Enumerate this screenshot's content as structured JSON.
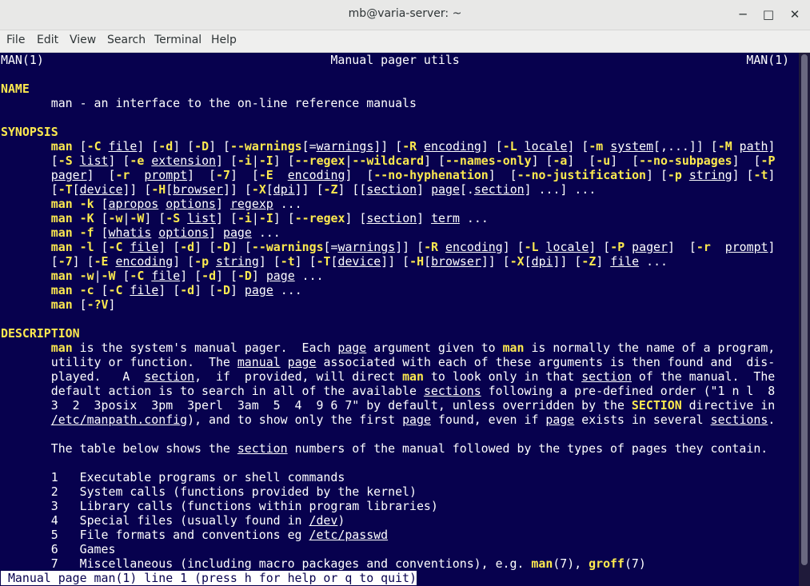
{
  "window": {
    "title": "mb@varia-server: ~",
    "minimize_label": "─",
    "maximize_label": "□",
    "close_label": "✕"
  },
  "menubar": [
    "File",
    "Edit",
    "View",
    "Search",
    "Terminal",
    "Help"
  ],
  "terminal": {
    "lines": [
      [
        {
          "t": "MAN(1)                                        Manual pager utils                                        MAN(1)"
        }
      ],
      [],
      [
        {
          "t": "NAME",
          "s": "b"
        }
      ],
      [
        {
          "t": "       man - an interface to the on-line reference manuals"
        }
      ],
      [],
      [
        {
          "t": "SYNOPSIS",
          "s": "b"
        }
      ],
      [
        {
          "t": "       "
        },
        {
          "t": "man",
          "s": "b"
        },
        {
          "t": " ["
        },
        {
          "t": "-C",
          "s": "b"
        },
        {
          "t": " "
        },
        {
          "t": "file",
          "s": "u"
        },
        {
          "t": "] ["
        },
        {
          "t": "-d",
          "s": "b"
        },
        {
          "t": "] ["
        },
        {
          "t": "-D",
          "s": "b"
        },
        {
          "t": "] ["
        },
        {
          "t": "--warnings",
          "s": "b"
        },
        {
          "t": "[="
        },
        {
          "t": "warnings",
          "s": "u"
        },
        {
          "t": "]] ["
        },
        {
          "t": "-R",
          "s": "b"
        },
        {
          "t": " "
        },
        {
          "t": "encoding",
          "s": "u"
        },
        {
          "t": "] ["
        },
        {
          "t": "-L",
          "s": "b"
        },
        {
          "t": " "
        },
        {
          "t": "locale",
          "s": "u"
        },
        {
          "t": "] ["
        },
        {
          "t": "-m",
          "s": "b"
        },
        {
          "t": " "
        },
        {
          "t": "system",
          "s": "u"
        },
        {
          "t": "[,...]] ["
        },
        {
          "t": "-M",
          "s": "b"
        },
        {
          "t": " "
        },
        {
          "t": "path",
          "s": "u"
        },
        {
          "t": "]"
        }
      ],
      [
        {
          "t": "       ["
        },
        {
          "t": "-S",
          "s": "b"
        },
        {
          "t": " "
        },
        {
          "t": "list",
          "s": "u"
        },
        {
          "t": "] ["
        },
        {
          "t": "-e",
          "s": "b"
        },
        {
          "t": " "
        },
        {
          "t": "extension",
          "s": "u"
        },
        {
          "t": "] ["
        },
        {
          "t": "-i",
          "s": "b"
        },
        {
          "t": "|"
        },
        {
          "t": "-I",
          "s": "b"
        },
        {
          "t": "] ["
        },
        {
          "t": "--regex",
          "s": "b"
        },
        {
          "t": "|"
        },
        {
          "t": "--wildcard",
          "s": "b"
        },
        {
          "t": "] ["
        },
        {
          "t": "--names-only",
          "s": "b"
        },
        {
          "t": "] ["
        },
        {
          "t": "-a",
          "s": "b"
        },
        {
          "t": "]  ["
        },
        {
          "t": "-u",
          "s": "b"
        },
        {
          "t": "]  ["
        },
        {
          "t": "--no-subpages",
          "s": "b"
        },
        {
          "t": "]  ["
        },
        {
          "t": "-P",
          "s": "b"
        }
      ],
      [
        {
          "t": "       "
        },
        {
          "t": "pager",
          "s": "u"
        },
        {
          "t": "]  ["
        },
        {
          "t": "-r",
          "s": "b"
        },
        {
          "t": "  "
        },
        {
          "t": "prompt",
          "s": "u"
        },
        {
          "t": "]  ["
        },
        {
          "t": "-7",
          "s": "b"
        },
        {
          "t": "]  ["
        },
        {
          "t": "-E",
          "s": "b"
        },
        {
          "t": "  "
        },
        {
          "t": "encoding",
          "s": "u"
        },
        {
          "t": "]  ["
        },
        {
          "t": "--no-hyphenation",
          "s": "b"
        },
        {
          "t": "]  ["
        },
        {
          "t": "--no-justification",
          "s": "b"
        },
        {
          "t": "] ["
        },
        {
          "t": "-p",
          "s": "b"
        },
        {
          "t": " "
        },
        {
          "t": "string",
          "s": "u"
        },
        {
          "t": "] ["
        },
        {
          "t": "-t",
          "s": "b"
        },
        {
          "t": "]"
        }
      ],
      [
        {
          "t": "       ["
        },
        {
          "t": "-T",
          "s": "b"
        },
        {
          "t": "["
        },
        {
          "t": "device",
          "s": "u"
        },
        {
          "t": "]] ["
        },
        {
          "t": "-H",
          "s": "b"
        },
        {
          "t": "["
        },
        {
          "t": "browser",
          "s": "u"
        },
        {
          "t": "]] ["
        },
        {
          "t": "-X",
          "s": "b"
        },
        {
          "t": "["
        },
        {
          "t": "dpi",
          "s": "u"
        },
        {
          "t": "]] ["
        },
        {
          "t": "-Z",
          "s": "b"
        },
        {
          "t": "] [["
        },
        {
          "t": "section",
          "s": "u"
        },
        {
          "t": "] "
        },
        {
          "t": "page",
          "s": "u"
        },
        {
          "t": "[."
        },
        {
          "t": "section",
          "s": "u"
        },
        {
          "t": "] ...] ..."
        }
      ],
      [
        {
          "t": "       "
        },
        {
          "t": "man",
          "s": "b"
        },
        {
          "t": " "
        },
        {
          "t": "-k",
          "s": "b"
        },
        {
          "t": " ["
        },
        {
          "t": "apropos",
          "s": "u"
        },
        {
          "t": " "
        },
        {
          "t": "options",
          "s": "u"
        },
        {
          "t": "] "
        },
        {
          "t": "regexp",
          "s": "u"
        },
        {
          "t": " ..."
        }
      ],
      [
        {
          "t": "       "
        },
        {
          "t": "man",
          "s": "b"
        },
        {
          "t": " "
        },
        {
          "t": "-K",
          "s": "b"
        },
        {
          "t": " ["
        },
        {
          "t": "-w",
          "s": "b"
        },
        {
          "t": "|"
        },
        {
          "t": "-W",
          "s": "b"
        },
        {
          "t": "] ["
        },
        {
          "t": "-S",
          "s": "b"
        },
        {
          "t": " "
        },
        {
          "t": "list",
          "s": "u"
        },
        {
          "t": "] ["
        },
        {
          "t": "-i",
          "s": "b"
        },
        {
          "t": "|"
        },
        {
          "t": "-I",
          "s": "b"
        },
        {
          "t": "] ["
        },
        {
          "t": "--regex",
          "s": "b"
        },
        {
          "t": "] ["
        },
        {
          "t": "section",
          "s": "u"
        },
        {
          "t": "] "
        },
        {
          "t": "term",
          "s": "u"
        },
        {
          "t": " ..."
        }
      ],
      [
        {
          "t": "       "
        },
        {
          "t": "man",
          "s": "b"
        },
        {
          "t": " "
        },
        {
          "t": "-f",
          "s": "b"
        },
        {
          "t": " ["
        },
        {
          "t": "whatis",
          "s": "u"
        },
        {
          "t": " "
        },
        {
          "t": "options",
          "s": "u"
        },
        {
          "t": "] "
        },
        {
          "t": "page",
          "s": "u"
        },
        {
          "t": " ..."
        }
      ],
      [
        {
          "t": "       "
        },
        {
          "t": "man",
          "s": "b"
        },
        {
          "t": " "
        },
        {
          "t": "-l",
          "s": "b"
        },
        {
          "t": " ["
        },
        {
          "t": "-C",
          "s": "b"
        },
        {
          "t": " "
        },
        {
          "t": "file",
          "s": "u"
        },
        {
          "t": "] ["
        },
        {
          "t": "-d",
          "s": "b"
        },
        {
          "t": "] ["
        },
        {
          "t": "-D",
          "s": "b"
        },
        {
          "t": "] ["
        },
        {
          "t": "--warnings",
          "s": "b"
        },
        {
          "t": "[="
        },
        {
          "t": "warnings",
          "s": "u"
        },
        {
          "t": "]] ["
        },
        {
          "t": "-R",
          "s": "b"
        },
        {
          "t": " "
        },
        {
          "t": "encoding",
          "s": "u"
        },
        {
          "t": "] ["
        },
        {
          "t": "-L",
          "s": "b"
        },
        {
          "t": " "
        },
        {
          "t": "locale",
          "s": "u"
        },
        {
          "t": "] ["
        },
        {
          "t": "-P",
          "s": "b"
        },
        {
          "t": " "
        },
        {
          "t": "pager",
          "s": "u"
        },
        {
          "t": "]  ["
        },
        {
          "t": "-r",
          "s": "b"
        },
        {
          "t": "  "
        },
        {
          "t": "prompt",
          "s": "u"
        },
        {
          "t": "]"
        }
      ],
      [
        {
          "t": "       ["
        },
        {
          "t": "-7",
          "s": "b"
        },
        {
          "t": "] ["
        },
        {
          "t": "-E",
          "s": "b"
        },
        {
          "t": " "
        },
        {
          "t": "encoding",
          "s": "u"
        },
        {
          "t": "] ["
        },
        {
          "t": "-p",
          "s": "b"
        },
        {
          "t": " "
        },
        {
          "t": "string",
          "s": "u"
        },
        {
          "t": "] ["
        },
        {
          "t": "-t",
          "s": "b"
        },
        {
          "t": "] ["
        },
        {
          "t": "-T",
          "s": "b"
        },
        {
          "t": "["
        },
        {
          "t": "device",
          "s": "u"
        },
        {
          "t": "]] ["
        },
        {
          "t": "-H",
          "s": "b"
        },
        {
          "t": "["
        },
        {
          "t": "browser",
          "s": "u"
        },
        {
          "t": "]] ["
        },
        {
          "t": "-X",
          "s": "b"
        },
        {
          "t": "["
        },
        {
          "t": "dpi",
          "s": "u"
        },
        {
          "t": "]] ["
        },
        {
          "t": "-Z",
          "s": "b"
        },
        {
          "t": "] "
        },
        {
          "t": "file",
          "s": "u"
        },
        {
          "t": " ..."
        }
      ],
      [
        {
          "t": "       "
        },
        {
          "t": "man",
          "s": "b"
        },
        {
          "t": " "
        },
        {
          "t": "-w",
          "s": "b"
        },
        {
          "t": "|"
        },
        {
          "t": "-W",
          "s": "b"
        },
        {
          "t": " ["
        },
        {
          "t": "-C",
          "s": "b"
        },
        {
          "t": " "
        },
        {
          "t": "file",
          "s": "u"
        },
        {
          "t": "] ["
        },
        {
          "t": "-d",
          "s": "b"
        },
        {
          "t": "] ["
        },
        {
          "t": "-D",
          "s": "b"
        },
        {
          "t": "] "
        },
        {
          "t": "page",
          "s": "u"
        },
        {
          "t": " ..."
        }
      ],
      [
        {
          "t": "       "
        },
        {
          "t": "man",
          "s": "b"
        },
        {
          "t": " "
        },
        {
          "t": "-c",
          "s": "b"
        },
        {
          "t": " ["
        },
        {
          "t": "-C",
          "s": "b"
        },
        {
          "t": " "
        },
        {
          "t": "file",
          "s": "u"
        },
        {
          "t": "] ["
        },
        {
          "t": "-d",
          "s": "b"
        },
        {
          "t": "] ["
        },
        {
          "t": "-D",
          "s": "b"
        },
        {
          "t": "] "
        },
        {
          "t": "page",
          "s": "u"
        },
        {
          "t": " ..."
        }
      ],
      [
        {
          "t": "       "
        },
        {
          "t": "man",
          "s": "b"
        },
        {
          "t": " ["
        },
        {
          "t": "-?V",
          "s": "b"
        },
        {
          "t": "]"
        }
      ],
      [],
      [
        {
          "t": "DESCRIPTION",
          "s": "b"
        }
      ],
      [
        {
          "t": "       "
        },
        {
          "t": "man",
          "s": "b"
        },
        {
          "t": " is the system's manual pager.  Each "
        },
        {
          "t": "page",
          "s": "u"
        },
        {
          "t": " argument given to "
        },
        {
          "t": "man",
          "s": "b"
        },
        {
          "t": " is normally the name of a program,"
        }
      ],
      [
        {
          "t": "       utility or function.  The "
        },
        {
          "t": "manual",
          "s": "u"
        },
        {
          "t": " "
        },
        {
          "t": "page",
          "s": "u"
        },
        {
          "t": " associated with each of these arguments is then found and  dis-"
        }
      ],
      [
        {
          "t": "       played.   A  "
        },
        {
          "t": "section",
          "s": "u"
        },
        {
          "t": ",  if  provided, will direct "
        },
        {
          "t": "man",
          "s": "b"
        },
        {
          "t": " to look only in that "
        },
        {
          "t": "section",
          "s": "u"
        },
        {
          "t": " of the manual.  The"
        }
      ],
      [
        {
          "t": "       default action is to search in all of the available "
        },
        {
          "t": "sections",
          "s": "u"
        },
        {
          "t": " following a pre-defined order (\"1 n l  8"
        }
      ],
      [
        {
          "t": "       3  2  3posix  3pm  3perl  3am  5  4  9 6 7\" by default, unless overridden by the "
        },
        {
          "t": "SECTION",
          "s": "b"
        },
        {
          "t": " directive in"
        }
      ],
      [
        {
          "t": "       "
        },
        {
          "t": "/etc/manpath.config",
          "s": "u"
        },
        {
          "t": "), and to show only the first "
        },
        {
          "t": "page",
          "s": "u"
        },
        {
          "t": " found, even if "
        },
        {
          "t": "page",
          "s": "u"
        },
        {
          "t": " exists in several "
        },
        {
          "t": "sections",
          "s": "u"
        },
        {
          "t": "."
        }
      ],
      [],
      [
        {
          "t": "       The table below shows the "
        },
        {
          "t": "section",
          "s": "u"
        },
        {
          "t": " numbers of the manual followed by the types of pages they contain."
        }
      ],
      [],
      [
        {
          "t": "       1   Executable programs or shell commands"
        }
      ],
      [
        {
          "t": "       2   System calls (functions provided by the kernel)"
        }
      ],
      [
        {
          "t": "       3   Library calls (functions within program libraries)"
        }
      ],
      [
        {
          "t": "       4   Special files (usually found in "
        },
        {
          "t": "/dev",
          "s": "u"
        },
        {
          "t": ")"
        }
      ],
      [
        {
          "t": "       5   File formats and conventions eg "
        },
        {
          "t": "/etc/passwd",
          "s": "u"
        }
      ],
      [
        {
          "t": "       6   Games"
        }
      ],
      [
        {
          "t": "       7   Miscellaneous (including macro packages and conventions), e.g. "
        },
        {
          "t": "man",
          "s": "b"
        },
        {
          "t": "(7), "
        },
        {
          "t": "groff",
          "s": "b"
        },
        {
          "t": "(7)"
        }
      ]
    ],
    "status_line": " Manual page man(1) line 1 (press h for help or q to quit)"
  }
}
